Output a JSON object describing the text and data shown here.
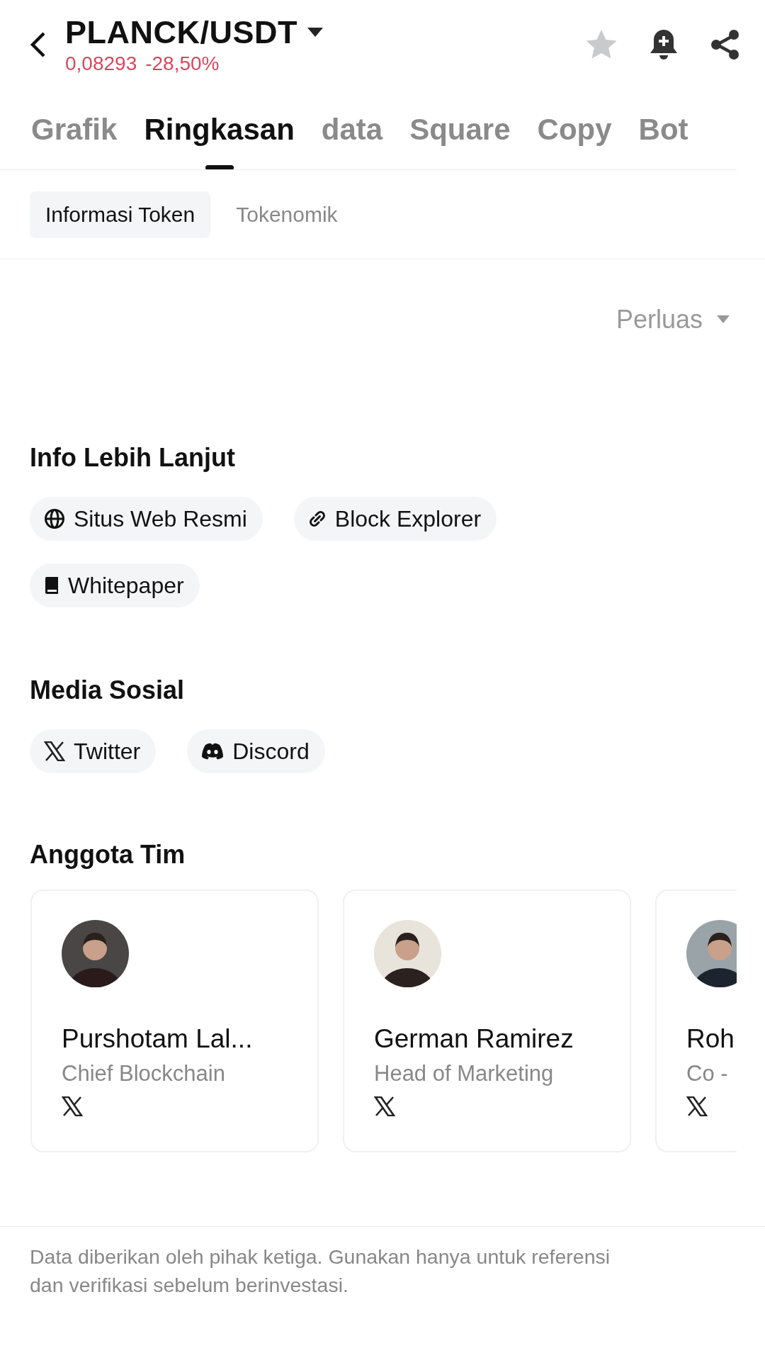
{
  "header": {
    "pair": "PLANCK/USDT",
    "price": "0,08293",
    "change": "-28,50%",
    "favorite": false
  },
  "tabs": [
    {
      "label": "Grafik",
      "selected": false
    },
    {
      "label": "Ringkasan",
      "selected": true
    },
    {
      "label": "data",
      "selected": false
    },
    {
      "label": "Square",
      "selected": false
    },
    {
      "label": "Copy",
      "selected": false
    },
    {
      "label": "Bot",
      "selected": false
    }
  ],
  "sub_tabs": [
    {
      "label": "Informasi Token",
      "selected": true
    },
    {
      "label": "Tokenomik",
      "selected": false
    }
  ],
  "expand_link": "Perluas",
  "sections": [
    {
      "title": "Info Lebih Lanjut",
      "links": [
        {
          "label": "Situs Web Resmi",
          "kind": "globe"
        },
        {
          "label": "Block Explorer",
          "kind": "link"
        },
        {
          "label": "Whitepaper",
          "kind": "book"
        }
      ]
    },
    {
      "title": "Media Sosial",
      "links": [
        {
          "label": "Twitter",
          "kind": "x"
        },
        {
          "label": "Discord",
          "kind": "discord"
        }
      ]
    }
  ],
  "team": {
    "title": "Anggota Tim",
    "members": [
      {
        "name": "Purshotam Lal...",
        "role": "Chief Blockchain"
      },
      {
        "name": "German Ramirez",
        "role": "Head of Marketing"
      },
      {
        "name": "Roh",
        "role": "Co -"
      }
    ]
  },
  "footer": "Data diberikan oleh pihak ketiga. Gunakan hanya untuk referensi dan verifikasi sebelum berinvestasi."
}
